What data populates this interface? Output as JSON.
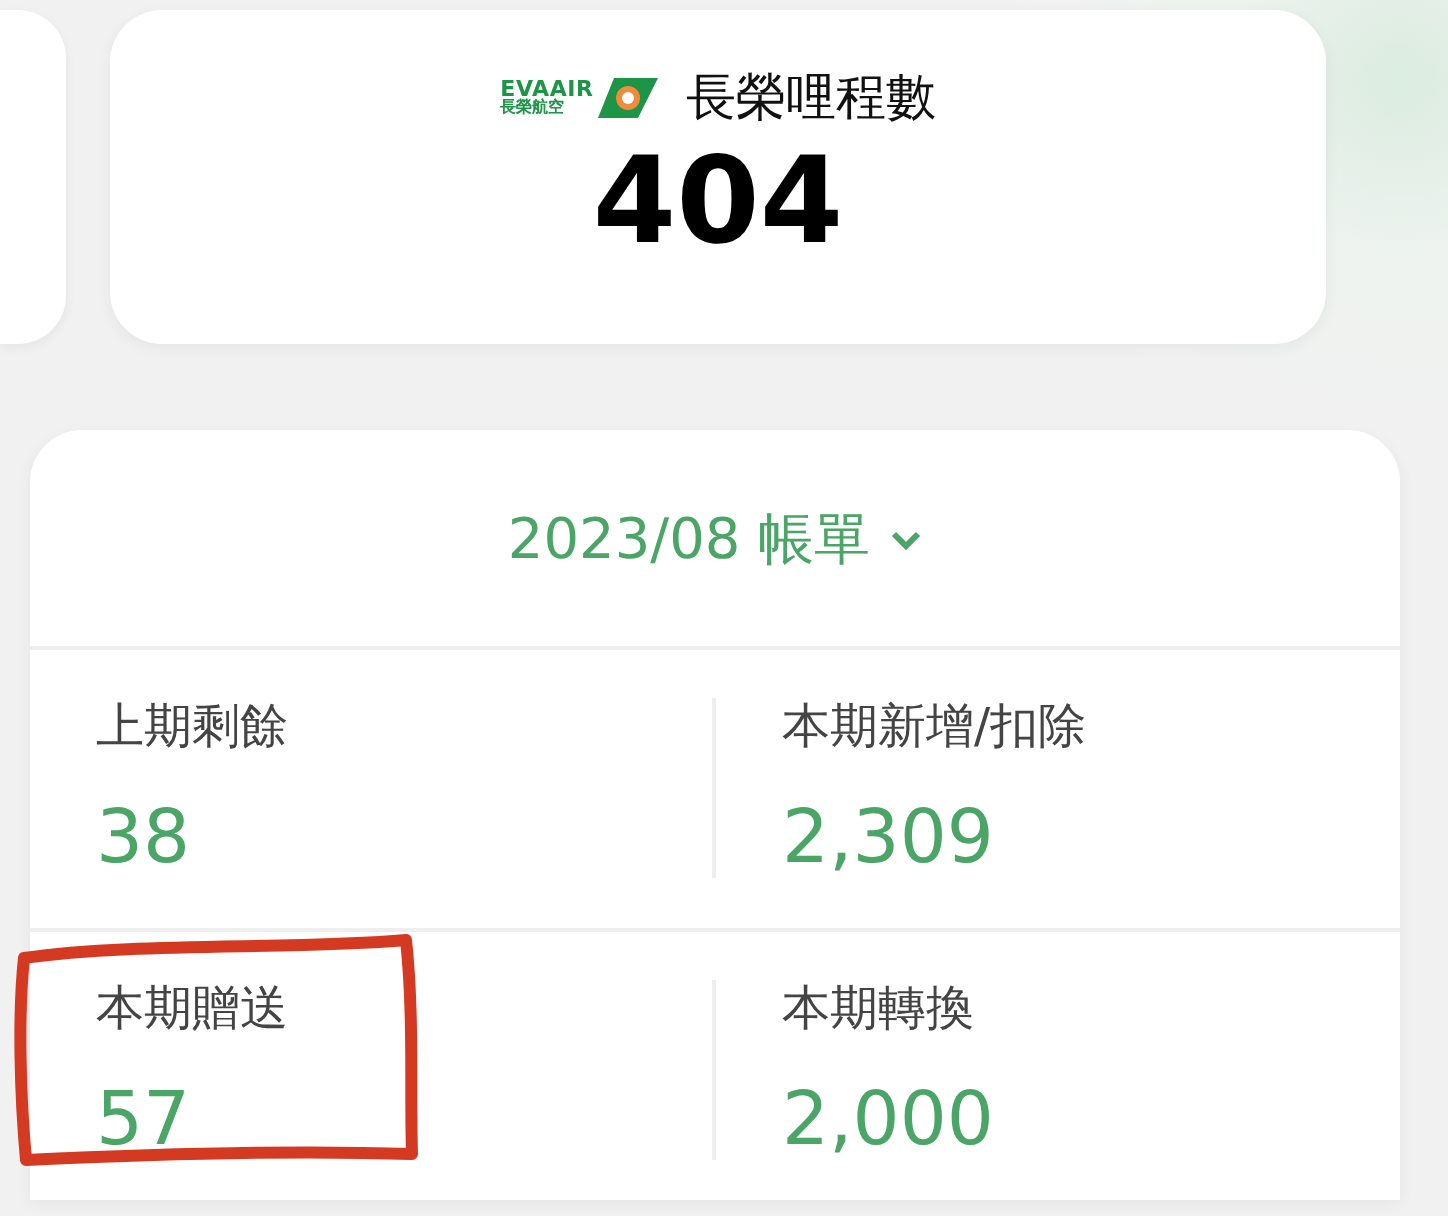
{
  "miles_card": {
    "logo": {
      "latin": "EVAAIR",
      "chinese": "長榮航空"
    },
    "title": "長榮哩程數",
    "value": "404"
  },
  "statement": {
    "period": "2023/08 帳單",
    "stats": [
      {
        "label": "上期剩餘",
        "value": "38",
        "annotated": false
      },
      {
        "label": "本期新增/扣除",
        "value": "2,309",
        "annotated": false
      },
      {
        "label": "本期贈送",
        "value": "57",
        "annotated": true
      },
      {
        "label": "本期轉換",
        "value": "2,000",
        "annotated": false
      }
    ]
  }
}
